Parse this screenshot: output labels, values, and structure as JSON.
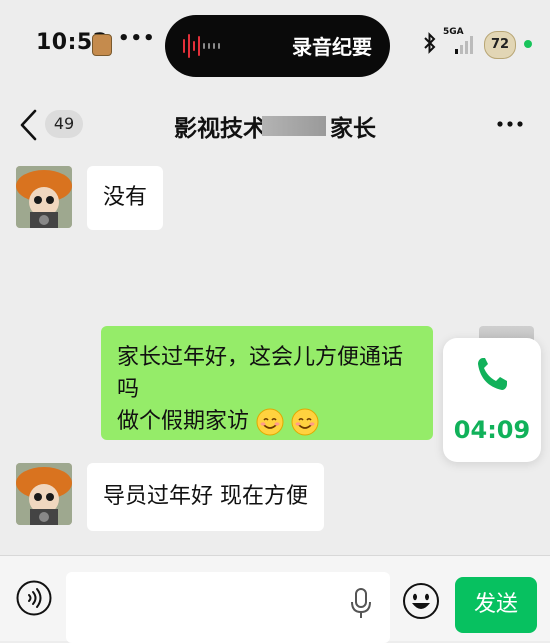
{
  "status_bar": {
    "time": "10:52",
    "dots": "•••",
    "recording_label": "录音纪要",
    "network": "5GA",
    "battery": "72"
  },
  "nav": {
    "unread_count": "49",
    "title": "影视技术",
    "title_suffix": "家长"
  },
  "messages": [
    {
      "sender": "other",
      "text": "没有"
    },
    {
      "sender": "me",
      "line1": "家长过年好，这会儿方便通话吗",
      "line2": "做个假期家访"
    },
    {
      "sender": "other",
      "text": "导员过年好 现在方便"
    }
  ],
  "call_card": {
    "duration": "04:09"
  },
  "input_bar": {
    "send_label": "发送",
    "input_value": ""
  },
  "colors": {
    "outgoing_bubble": "#95ec69",
    "send_button": "#07c160",
    "call_green": "#11b15a",
    "background": "#ededed"
  },
  "icons": [
    "voice-icon",
    "mic-icon",
    "emoji-icon",
    "phone-icon",
    "back-chevron-icon",
    "more-icon",
    "bluetooth-icon",
    "signal-icon"
  ]
}
